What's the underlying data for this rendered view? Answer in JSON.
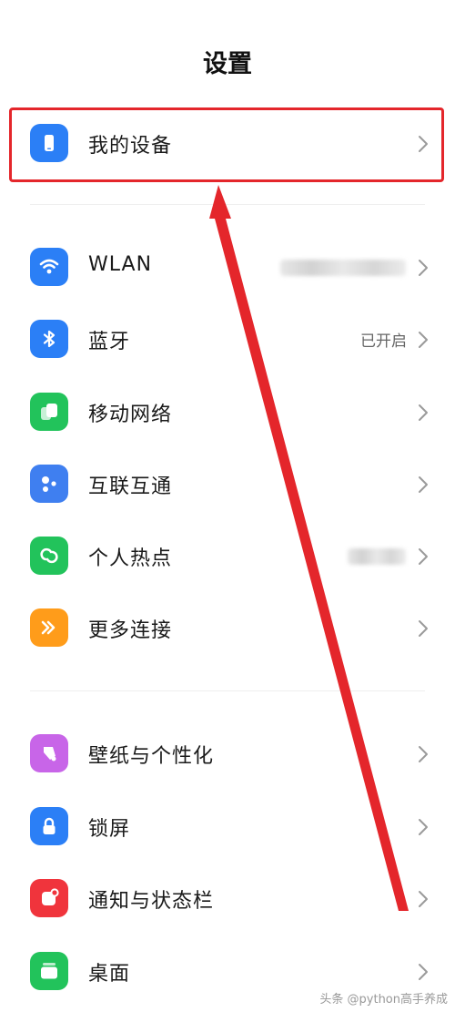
{
  "page": {
    "title": "设置"
  },
  "group1": [
    {
      "label": "我的设备",
      "icon": "phone-icon",
      "color": "#2b7ff6"
    }
  ],
  "group2": [
    {
      "label": "WLAN",
      "icon": "wifi-icon",
      "color": "#2b7ff6"
    },
    {
      "label": "蓝牙",
      "value": "已开启",
      "icon": "bluetooth-icon",
      "color": "#2b7ff6"
    },
    {
      "label": "移动网络",
      "icon": "mobile-network-icon",
      "color": "#22c35b"
    },
    {
      "label": "互联互通",
      "icon": "interconnect-icon",
      "color": "#3f7ff0"
    },
    {
      "label": "个人热点",
      "icon": "hotspot-icon",
      "color": "#22c35b"
    },
    {
      "label": "更多连接",
      "icon": "more-connections-icon",
      "color": "#ff9c1a"
    }
  ],
  "group3": [
    {
      "label": "壁纸与个性化",
      "icon": "wallpaper-icon",
      "color": "#c865e8"
    },
    {
      "label": "锁屏",
      "icon": "lock-icon",
      "color": "#2b7ff6"
    },
    {
      "label": "通知与状态栏",
      "icon": "notification-icon",
      "color": "#f0343c"
    },
    {
      "label": "桌面",
      "icon": "desktop-icon",
      "color": "#22c35b"
    }
  ],
  "annotation": {
    "highlight_color": "#e4262b"
  },
  "watermark": "头条 @python高手养成"
}
